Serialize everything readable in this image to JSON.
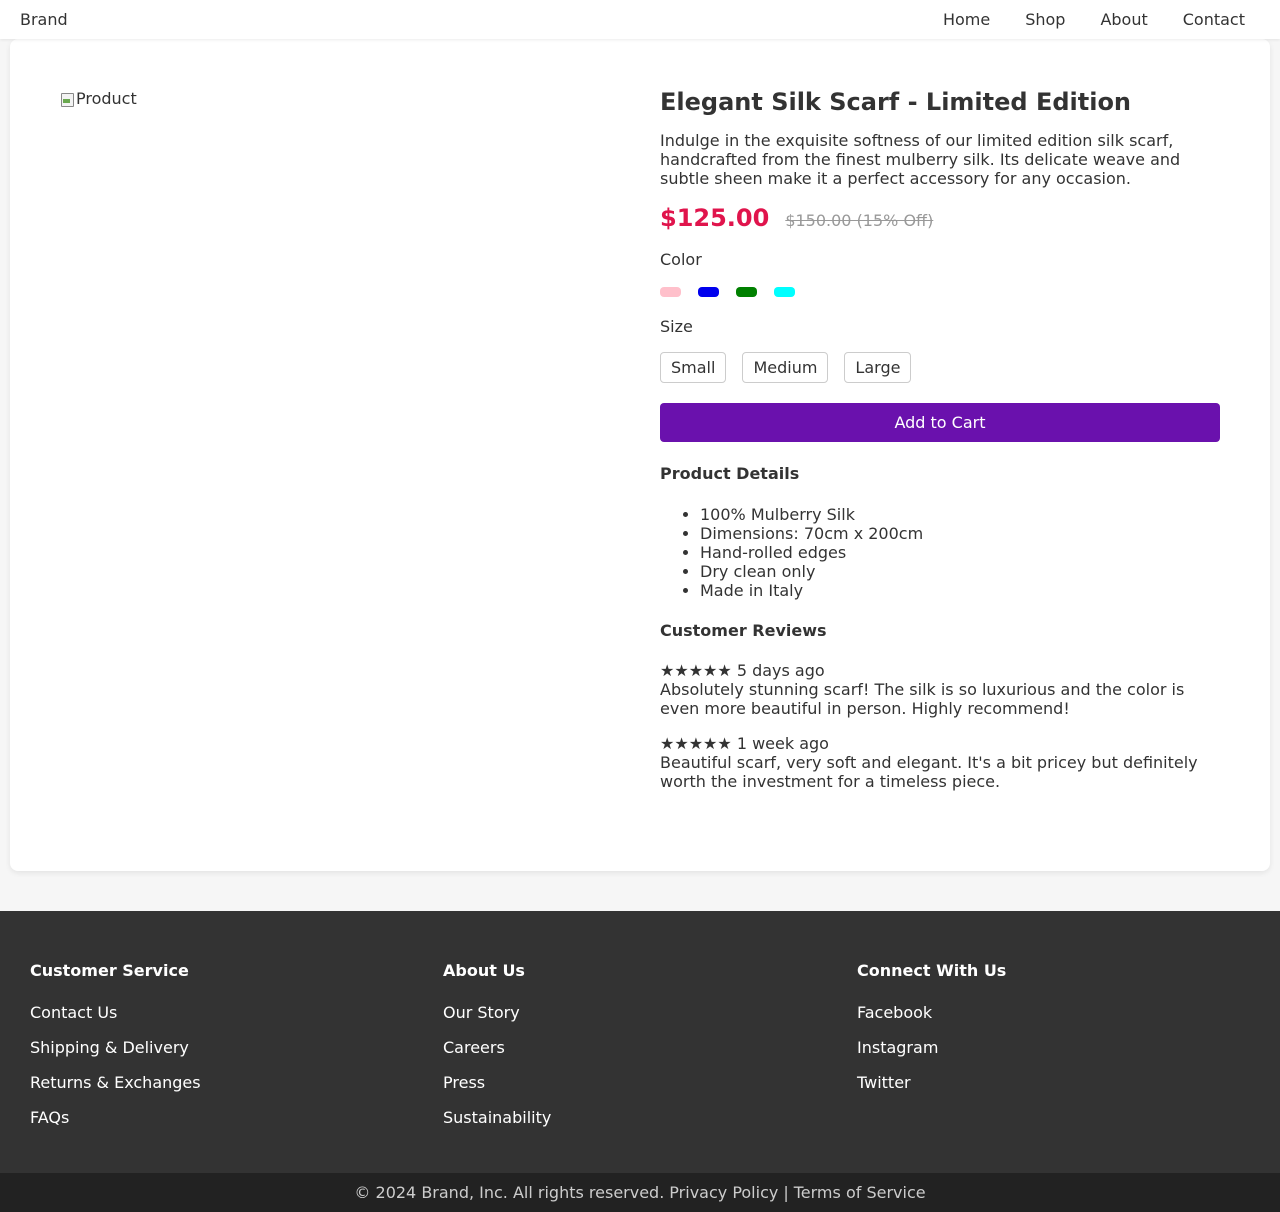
{
  "nav": {
    "brand": "Brand",
    "links": [
      "Home",
      "Shop",
      "About",
      "Contact"
    ]
  },
  "product": {
    "image_alt": "Product",
    "title": "Elegant Silk Scarf - Limited Edition",
    "description": "Indulge in the exquisite softness of our limited edition silk scarf, handcrafted from the finest mulberry silk. Its delicate weave and subtle sheen make it a perfect accessory for any occasion.",
    "price": "$125.00",
    "old_price": "$150.00 (15% Off)",
    "color_label": "Color",
    "colors": [
      "#ffc0cb",
      "#0000ee",
      "#008000",
      "#00ffff"
    ],
    "size_label": "Size",
    "sizes": [
      "Small",
      "Medium",
      "Large"
    ],
    "cart_label": "Add to Cart",
    "accent": "#6a11ad",
    "price_color": "#e0144c",
    "details_title": "Product Details",
    "details": [
      "100% Mulberry Silk",
      "Dimensions: 70cm x 200cm",
      "Hand-rolled edges",
      "Dry clean only",
      "Made in Italy"
    ],
    "reviews_title": "Customer Reviews",
    "reviews": [
      {
        "stars": "★★★★★",
        "when": "5 days ago",
        "text": "Absolutely stunning scarf! The silk is so luxurious and the color is even more beautiful in person. Highly recommend!"
      },
      {
        "stars": "★★★★★",
        "when": "1 week ago",
        "text": "Beautiful scarf, very soft and elegant. It's a bit pricey but definitely worth the investment for a timeless piece."
      }
    ]
  },
  "footer": {
    "columns": [
      {
        "title": "Customer Service",
        "links": [
          "Contact Us",
          "Shipping & Delivery",
          "Returns & Exchanges",
          "FAQs"
        ]
      },
      {
        "title": "About Us",
        "links": [
          "Our Story",
          "Careers",
          "Press",
          "Sustainability"
        ]
      },
      {
        "title": "Connect With Us",
        "links": [
          "Facebook",
          "Instagram",
          "Twitter"
        ]
      }
    ],
    "copyright": "© 2024 Brand, Inc. All rights reserved.",
    "privacy": "Privacy Policy",
    "separator": "|",
    "terms": "Terms of Service"
  }
}
